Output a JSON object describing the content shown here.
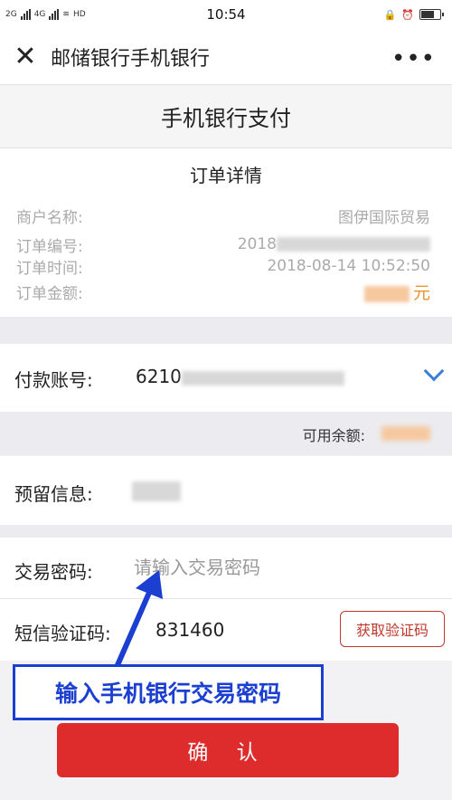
{
  "status_bar": {
    "left_text_1": "2G",
    "left_text_2": "4G",
    "left_text_3": "HD",
    "time": "10:54"
  },
  "nav": {
    "close_icon": "close-icon",
    "title": "邮储银行手机银行",
    "more_icon": "more-dots-icon"
  },
  "page": {
    "title": "手机银行支付"
  },
  "order": {
    "title": "订单详情",
    "rows": [
      {
        "label": "商户名称:",
        "value": "图伊国际贸易"
      },
      {
        "label": "订单编号:",
        "value": "2018"
      },
      {
        "label": "订单时间:",
        "value": "2018-08-14 10:52:50"
      },
      {
        "label": "订单金额:",
        "value": "元"
      }
    ]
  },
  "payment": {
    "account_label": "付款账号:",
    "account_value": "6210",
    "balance_label": "可用余额:",
    "reserved_label": "预留信息:",
    "password_label": "交易密码:",
    "password_placeholder": "请输入交易密码",
    "sms_label": "短信验证码:",
    "sms_value": "831460",
    "sms_button": "获取验证码"
  },
  "annotation": {
    "text": "输入手机银行交易密码"
  },
  "confirm_button": "确 认",
  "colors": {
    "accent_red": "#de2b2b",
    "annotation_blue": "#1b3fd1",
    "chevron_blue": "#3a7fd5",
    "amount_orange": "#e8952e"
  }
}
